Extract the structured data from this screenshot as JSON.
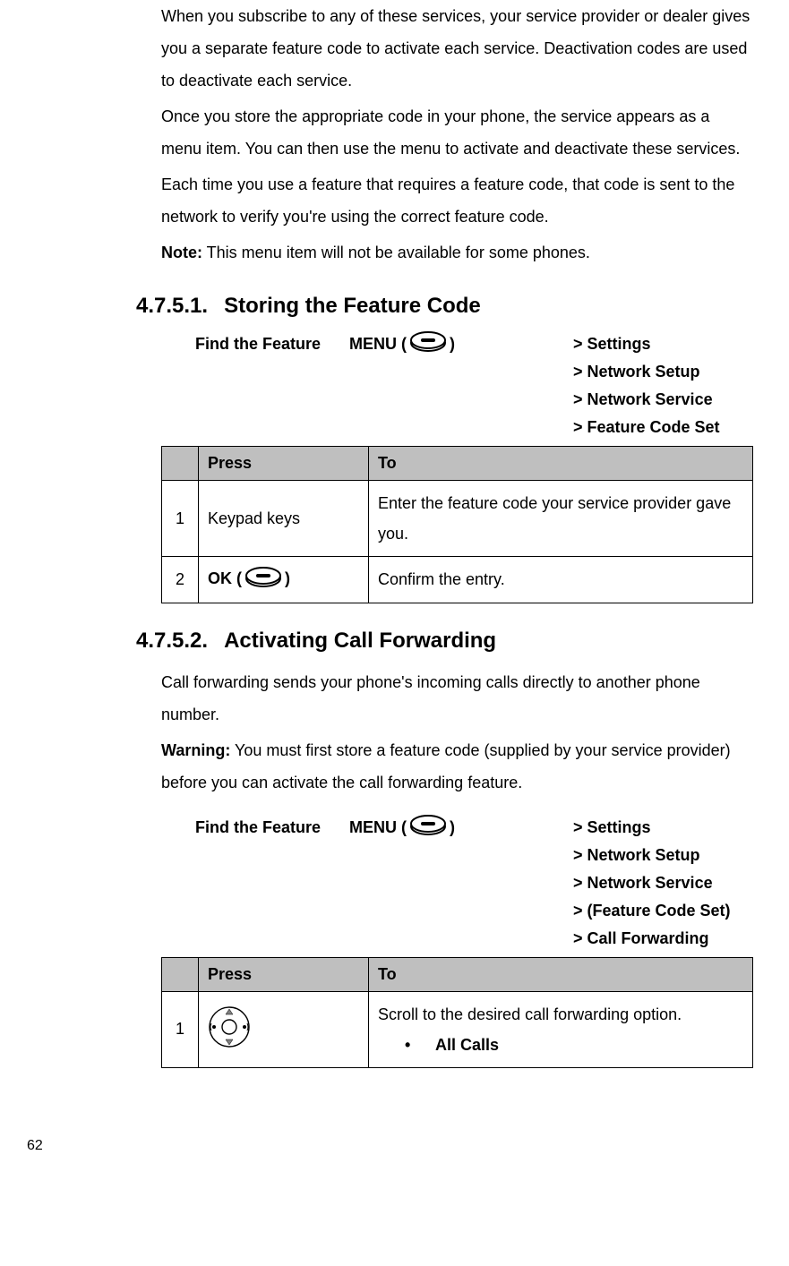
{
  "intro": {
    "p1": "When you subscribe to any of these services, your service provider or dealer gives you a separate feature code to activate each service. Deactivation codes are used to deactivate each service.",
    "p2": "Once you store the appropriate code in your phone, the service appears as a menu item. You can then use the menu to activate and deactivate these services.",
    "p3": "Each time you use a feature that requires a feature code, that code is sent to the network to verify you're using the correct feature code.",
    "note_label": "Note:",
    "note_text": " This menu item will not be available for some phones."
  },
  "section1": {
    "number": "4.7.5.1.",
    "title": "Storing the Feature Code",
    "find_label": "Find the Feature",
    "menu_prefix": "MENU (",
    "menu_suffix": ")",
    "path": [
      "> Settings",
      "> Network Setup",
      "> Network Service",
      "> Feature Code Set"
    ],
    "table": {
      "headers": [
        "",
        "Press",
        "To"
      ],
      "rows": [
        {
          "num": "1",
          "press": "Keypad keys",
          "to": "Enter the feature code your service provider gave you."
        },
        {
          "num": "2",
          "press_prefix": "OK (",
          "press_suffix": ")",
          "to": "Confirm the entry."
        }
      ]
    }
  },
  "section2": {
    "number": "4.7.5.2.",
    "title": "Activating Call Forwarding",
    "p1": "Call forwarding sends your phone's incoming calls directly to another phone number.",
    "warning_label": "Warning:",
    "warning_text": " You must first store a feature code (supplied by your service provider) before you can activate the call forwarding feature.",
    "find_label": "Find the Feature",
    "menu_prefix": "MENU (",
    "menu_suffix": ")",
    "path": [
      "> Settings",
      "> Network Setup",
      "> Network Service",
      "> (Feature Code Set)",
      "> Call Forwarding"
    ],
    "table": {
      "headers": [
        "",
        "Press",
        "To"
      ],
      "rows": [
        {
          "num": "1",
          "to_line1": "Scroll to the desired call forwarding option.",
          "bullet": "All Calls"
        }
      ]
    }
  },
  "page_number": "62"
}
